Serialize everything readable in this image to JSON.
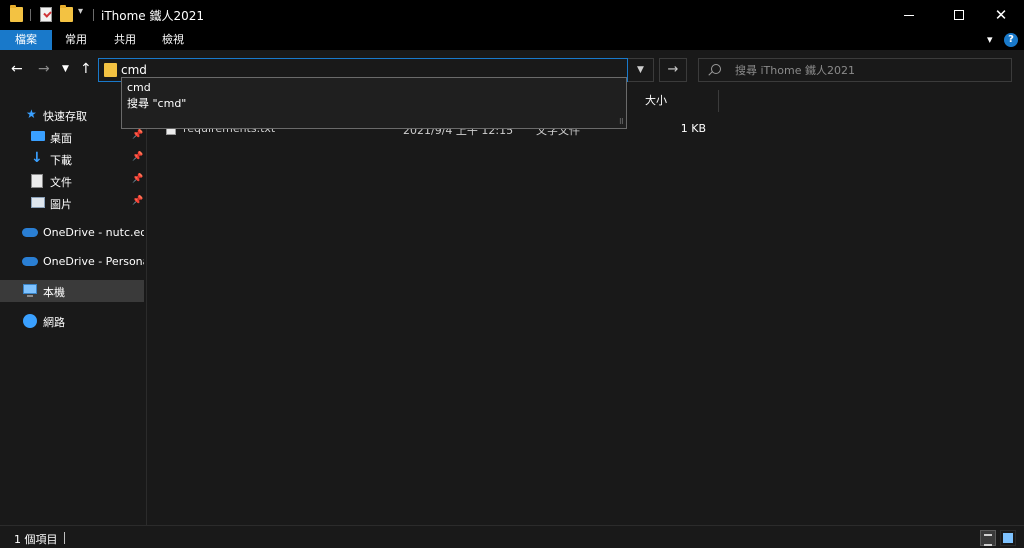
{
  "window": {
    "title": "iThome 鐵人2021",
    "minimize_glyph": "",
    "close_glyph": "✕"
  },
  "ribbon": {
    "tabs": [
      {
        "label": "檔案"
      },
      {
        "label": "常用"
      },
      {
        "label": "共用"
      },
      {
        "label": "檢視"
      }
    ]
  },
  "address": {
    "value": "cmd",
    "search_placeholder": "搜尋 iThome 鐵人2021"
  },
  "suggestions": [
    {
      "label": "cmd"
    },
    {
      "label": "搜尋 \"cmd\""
    }
  ],
  "sidebar": {
    "items": [
      {
        "label": "快速存取",
        "icon": "star-icon"
      },
      {
        "label": "桌面",
        "icon": "desktop-icon",
        "pinned": true
      },
      {
        "label": "下載",
        "icon": "download-icon",
        "pinned": true
      },
      {
        "label": "文件",
        "icon": "documents-icon",
        "pinned": true
      },
      {
        "label": "圖片",
        "icon": "pictures-icon",
        "pinned": true
      },
      {
        "label": "OneDrive - nutc.edu",
        "icon": "onedrive-icon"
      },
      {
        "label": "OneDrive - Personal",
        "icon": "onedrive-icon"
      },
      {
        "label": "本機",
        "icon": "this-pc-icon",
        "selected": true
      },
      {
        "label": "網路",
        "icon": "network-icon"
      }
    ]
  },
  "list": {
    "size_header": "大小",
    "files": [
      {
        "name": "requirements.txt",
        "modified": "2021/9/4 上午 12:15",
        "type": "文字文件",
        "size": "1 KB"
      }
    ]
  },
  "status": {
    "item_count": "1 個項目"
  },
  "colors": {
    "accent": "#1979ca",
    "background": "#191919",
    "titlebar": "#000000"
  }
}
